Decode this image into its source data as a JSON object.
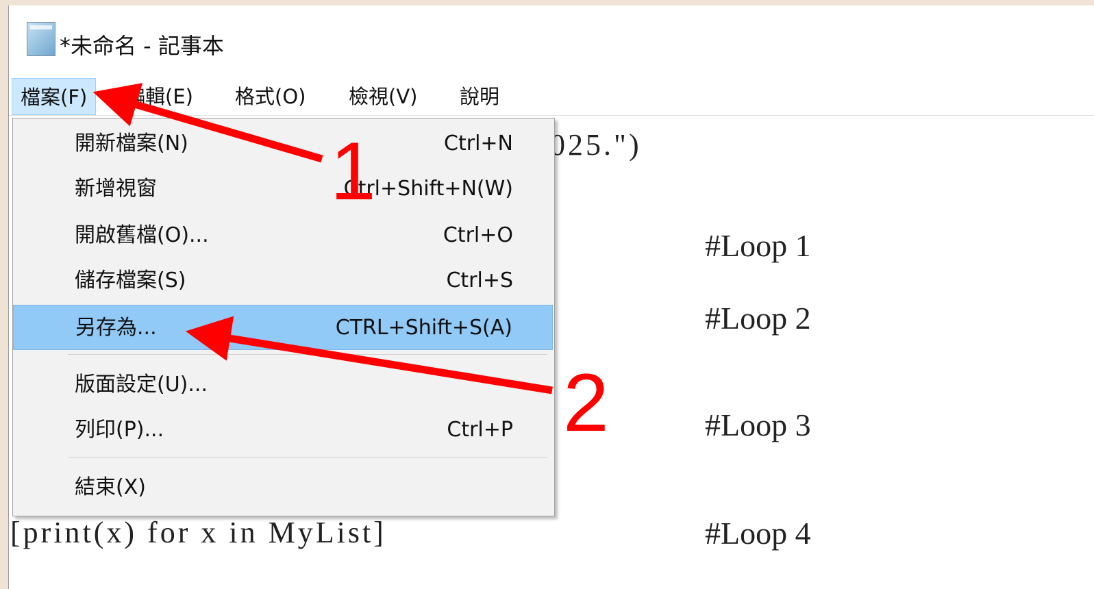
{
  "window": {
    "title": "*未命名 - 記事本"
  },
  "menubar": {
    "items": [
      "檔案(F)",
      "編輯(E)",
      "格式(O)",
      "檢視(V)",
      "說明"
    ]
  },
  "file_menu": {
    "items": [
      {
        "label": "開新檔案(N)",
        "shortcut": "Ctrl+N"
      },
      {
        "label": "新增視窗",
        "shortcut": "Ctrl+Shift+N(W)"
      },
      {
        "label": "開啟舊檔(O)...",
        "shortcut": "Ctrl+O"
      },
      {
        "label": "儲存檔案(S)",
        "shortcut": "Ctrl+S"
      },
      {
        "label": "另存為...",
        "shortcut": "CTRL+Shift+S(A)"
      },
      {
        "label": "版面設定(U)...",
        "shortcut": ""
      },
      {
        "label": "列印(P)...",
        "shortcut": "Ctrl+P"
      },
      {
        "label": "結束(X)",
        "shortcut": ""
      }
    ],
    "highlighted_item": "另存為..."
  },
  "editor": {
    "visible_fragment_line1": "025.\")",
    "comments": [
      "#Loop 1",
      "#Loop 2",
      "#Loop 3",
      "#Loop 4"
    ],
    "code_line_loop4": "[print(x) for x in MyList]"
  },
  "annotations": {
    "step1": "1",
    "step2": "2",
    "color": "#ff0000"
  },
  "colors": {
    "menu_active_bg": "#cce8ff",
    "dropdown_highlight": "#91c9f7",
    "arrow": "#ff0000"
  }
}
